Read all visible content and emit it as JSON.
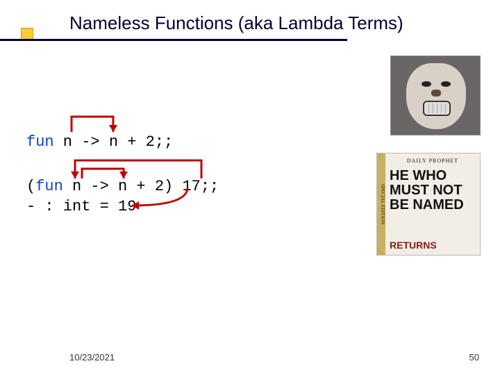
{
  "title": "Nameless Functions (aka Lambda Terms)",
  "code": {
    "kw": "fun",
    "line1_rest": " n -> n + 2;;",
    "line2_pre": "(",
    "line2_rest": " n -> n + 2) 17;;",
    "line3": "- : int = 19"
  },
  "poster": {
    "banner": "DAILY PROPHET",
    "headline": "HE WHO MUST NOT BE NAMED",
    "sub": "RETURNS",
    "strip": "SPECIAL EDITION"
  },
  "footer": {
    "date": "10/23/2021",
    "page": "50"
  }
}
